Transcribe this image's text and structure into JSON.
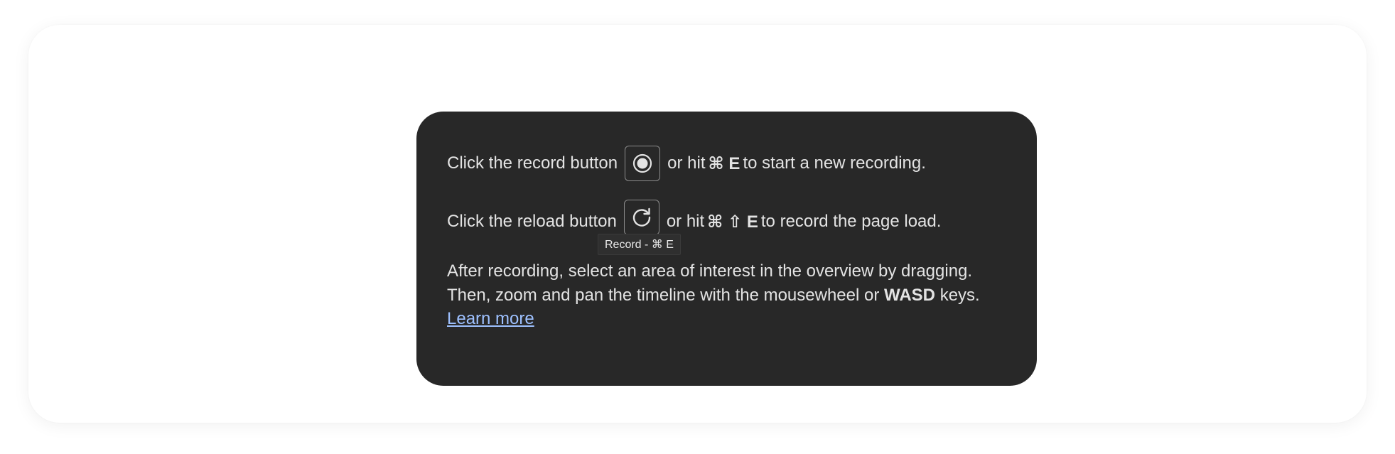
{
  "instructions": {
    "record_line": {
      "prefix": "Click the record button",
      "middle": "or hit",
      "shortcut": "⌘ E",
      "suffix": "to start a new recording.",
      "button_icon": "record-icon"
    },
    "reload_line": {
      "prefix": "Click the reload button",
      "middle": "or hit",
      "shortcut": "⌘ ⇧ E",
      "suffix": "to record the page load.",
      "button_icon": "reload-icon"
    },
    "tooltip": "Record - ⌘ E",
    "after_recording": {
      "line1": "After recording, select an area of interest in the overview by dragging.",
      "line2_prefix": "Then, zoom and pan the timeline with the mousewheel or",
      "line2_keys": "WASD",
      "line2_suffix": "keys.",
      "learn_more": "Learn more"
    }
  },
  "colors": {
    "panel_background": "#282828",
    "text": "#e3e3e3",
    "link": "#9ec1ff"
  }
}
